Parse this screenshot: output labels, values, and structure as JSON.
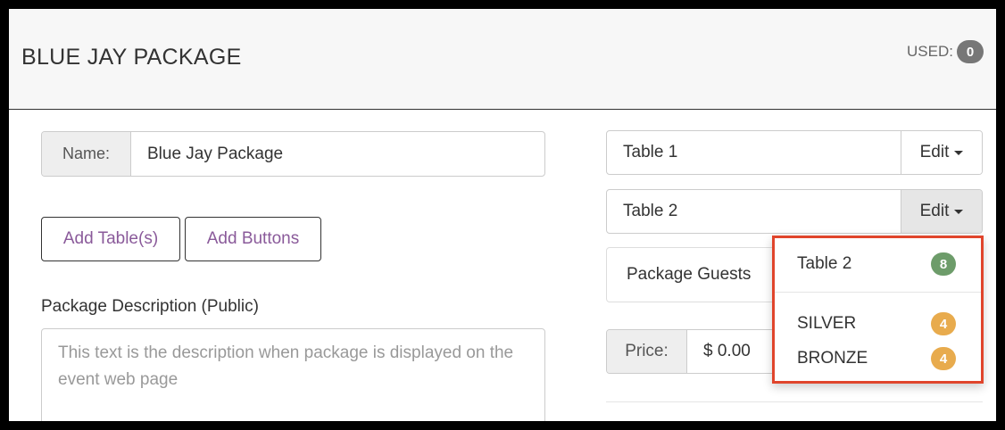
{
  "header": {
    "title": "BLUE JAY PACKAGE",
    "used_label": "USED:",
    "used_count": "0"
  },
  "form": {
    "name_label": "Name:",
    "name_value": "Blue Jay Package",
    "add_tables_label": "Add Table(s)",
    "add_buttons_label": "Add Buttons",
    "description_label": "Package Description (Public)",
    "description_placeholder": "This text is the description when package is displayed on the event web page"
  },
  "tables": [
    {
      "name": "Table 1",
      "edit_label": "Edit"
    },
    {
      "name": "Table 2",
      "edit_label": "Edit"
    }
  ],
  "guests_label": "Package Guests",
  "price": {
    "label": "Price:",
    "value": "$ 0.00"
  },
  "dropdown": {
    "items": [
      {
        "label": "Table 2",
        "count": "8",
        "color": "#6d9c6a"
      },
      {
        "label": "SILVER",
        "count": "4",
        "color": "#e8ab4d"
      },
      {
        "label": "BRONZE",
        "count": "4",
        "color": "#e8ab4d"
      }
    ]
  },
  "colors": {
    "highlight_border": "#e0452c",
    "link_purple": "#8a5a9a",
    "badge_dark": "#777777"
  }
}
